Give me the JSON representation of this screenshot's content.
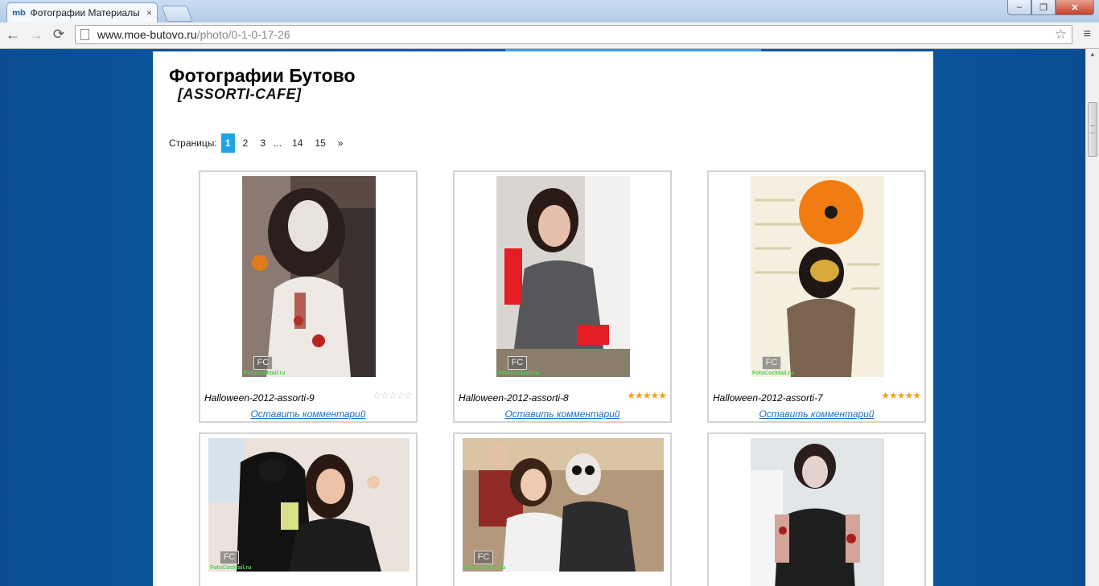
{
  "browser": {
    "tab_favicon": "mb",
    "tab_title": "Фотографии Материалы",
    "tab_close": "×",
    "url_host": "www.moe-butovo.ru",
    "url_path": "/photo/0-1-0-17-26",
    "back": "←",
    "forward": "→",
    "reload": "⟳",
    "star": "☆",
    "menu": "≡",
    "win_min": "–",
    "win_max": "❐",
    "win_close": "✕"
  },
  "page": {
    "title": "Фотографии Бутово",
    "subtitle": "[ASSORTI-CAFE]",
    "pager": {
      "label": "Страницы:",
      "current": "1",
      "pages": [
        "2",
        "3"
      ],
      "ellipsis": "...",
      "last_pages": [
        "14",
        "15"
      ],
      "next": "»"
    },
    "watermark": {
      "logo": "FC",
      "site": "FotoCocktail.ru"
    },
    "comment_label": "Оставить комментарий",
    "photos": [
      {
        "caption": "Halloween-2012-assorti-9",
        "rating": "☆☆☆☆☆",
        "rated": false
      },
      {
        "caption": "Halloween-2012-assorti-8",
        "rating": "★★★★★",
        "rated": true
      },
      {
        "caption": "Halloween-2012-assorti-7",
        "rating": "★★★★★",
        "rated": true
      }
    ]
  }
}
